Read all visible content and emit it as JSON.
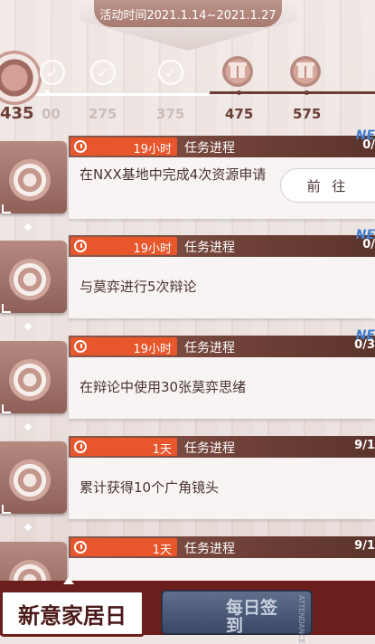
{
  "event": {
    "time_label": "活动时间2021.1.14~2021.1.27"
  },
  "progress": {
    "current": "435",
    "milestones": [
      {
        "value": "00",
        "state": "claimed"
      },
      {
        "value": "275",
        "state": "claimed"
      },
      {
        "value": "375",
        "state": "claimed"
      },
      {
        "value": "475",
        "state": "locked"
      },
      {
        "value": "575",
        "state": "locked"
      }
    ]
  },
  "tasks": [
    {
      "time": "19小时",
      "progress_label": "任务进程",
      "progress": "0/",
      "is_new": true,
      "new_label": "NE",
      "desc": "在NXX基地中完成4次资源申请",
      "action": "前 往"
    },
    {
      "time": "19小时",
      "progress_label": "任务进程",
      "progress": "0/",
      "is_new": true,
      "new_label": "NE",
      "desc": "与莫弈进行5次辩论"
    },
    {
      "time": "19小时",
      "progress_label": "任务进程",
      "progress": "0/3",
      "is_new": true,
      "new_label": "NE",
      "desc": "在辩论中使用30张莫弈思绪"
    },
    {
      "time": "1天",
      "progress_label": "任务进程",
      "progress": "9/1",
      "is_new": false,
      "desc": "累计获得10个广角镜头"
    },
    {
      "time": "1天",
      "progress_label": "任务进程",
      "progress": "9/1",
      "is_new": false,
      "desc": ""
    }
  ],
  "bottom_tabs": {
    "home": "新意家居日",
    "daily": "每日签到",
    "daily_en": "ATTENDANCE"
  },
  "colors": {
    "accent": "#e8562c",
    "header": "#6d3f36",
    "bottom": "#6b1f1c"
  }
}
